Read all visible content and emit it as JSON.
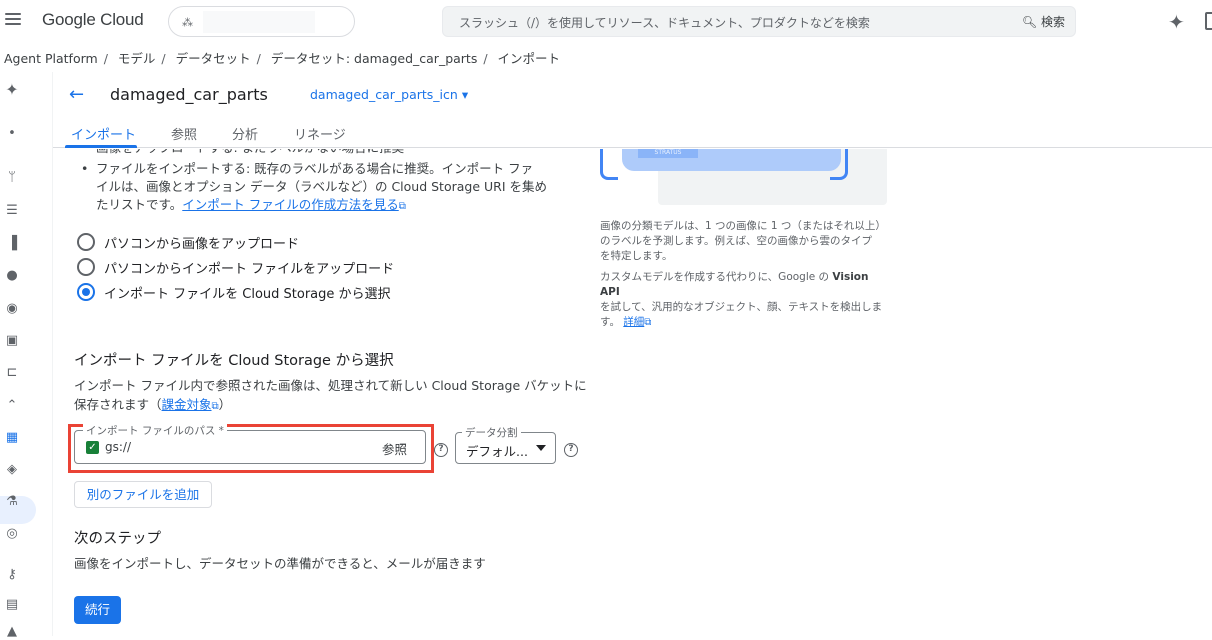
{
  "topbar": {
    "logo": "Google Cloud",
    "search_placeholder": "スラッシュ（/）を使用してリソース、ドキュメント、プロダクトなどを検索",
    "search_button": "検索"
  },
  "breadcrumb": [
    "Agent Platform",
    "モデル",
    "データセット",
    "データセット: damaged_car_parts",
    "インポート"
  ],
  "header": {
    "title": "damaged_car_parts",
    "dataset_select": "damaged_car_parts_icn"
  },
  "tabs": [
    "インポート",
    "参照",
    "分析",
    "リネージ"
  ],
  "bullets": {
    "partial": "画像をアップロードする: まだラベルがない場合に推奨",
    "file_line1": "ファイルをインポートする: 既存のラベルがある場合に推奨。インポート ファ",
    "file_line2": "イルは、画像とオプション データ（ラベルなど）の Cloud Storage URI を集め",
    "file_line3_prefix": "たリストです。",
    "file_link": "インポート ファイルの作成方法を見る"
  },
  "radios": [
    {
      "label": "パソコンから画像をアップロード",
      "selected": false
    },
    {
      "label": "パソコンからインポート ファイルをアップロード",
      "selected": false
    },
    {
      "label": "インポート ファイルを Cloud Storage から選択",
      "selected": true
    }
  ],
  "gcs_section": {
    "title": "インポート ファイルを Cloud Storage から選択",
    "desc_line1": "インポート ファイル内で参照された画像は、処理されて新しい Cloud Storage バケットに",
    "desc_line2_prefix": "保存されます（",
    "billing_link": "課金対象",
    "desc_line2_suffix": "）",
    "path_label": "インポート ファイルのパス *",
    "path_value": "gs://",
    "browse": "参照",
    "split_label": "データ分割",
    "split_value": "デフォル...",
    "add_file": "別のファイルを追加"
  },
  "next_steps": {
    "title": "次のステップ",
    "desc": "画像をインポートし、データセットの準備ができると、メールが届きます",
    "continue": "続行"
  },
  "side_panel": {
    "illus_tag": "STRATUS",
    "para1_line1": "画像の分類モデルは、1 つの画像に 1 つ（またはそれ以上）",
    "para1_line2": "のラベルを予測します。例えば、空の画像から雲のタイプ",
    "para1_line3": "を特定します。",
    "para2_line1_prefix": "カスタムモデルを作成する代わりに、Google の",
    "para2_bold": "Vision API",
    "para2_line2": "を試して、汎用的なオブジェクト、顔、テキストを検出しま",
    "para2_line3_prefix": "す。",
    "details_link": "詳細"
  },
  "colors": {
    "accent": "#1a73e8",
    "highlight": "#ea4335",
    "checkbox": "#188038"
  }
}
